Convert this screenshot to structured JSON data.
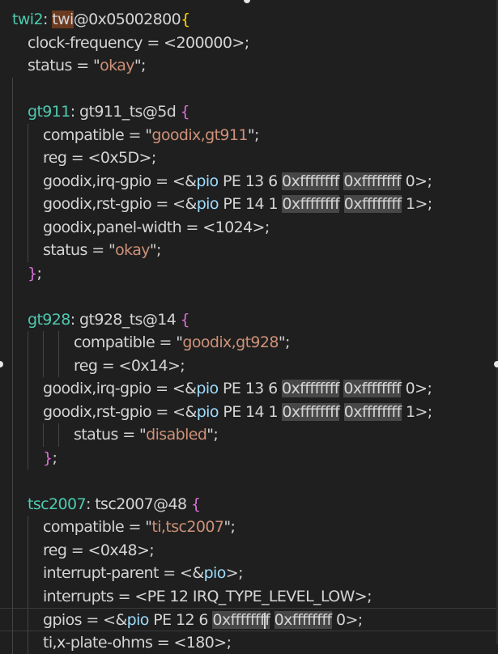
{
  "editor": {
    "lines": [
      "twi2: twi@0x05002800{",
      "clock-frequency = <200000>;",
      "status = \"okay\";",
      "",
      "gt911: gt911_ts@5d {",
      "compatible = \"goodix,gt911\";",
      "reg = <0x5D>;",
      "goodix,irq-gpio = <&pio PE 13 6 0xffffffff 0xffffffff 0>;",
      "goodix,rst-gpio = <&pio PE 14 1 0xffffffff 0xffffffff 1>;",
      "goodix,panel-width = <1024>;",
      "status = \"okay\";",
      "};",
      "",
      "gt928: gt928_ts@14 {",
      "compatible = \"goodix,gt928\";",
      "reg = <0x14>;",
      "goodix,irq-gpio = <&pio PE 13 6 0xffffffff 0xffffffff 0>;",
      "goodix,rst-gpio = <&pio PE 14 1 0xffffffff 0xffffffff 1>;",
      "status = \"disabled\";",
      "};",
      "",
      "tsc2007: tsc2007@48 {",
      "compatible = \"ti,tsc2007\";",
      "reg = <0x48>;",
      "interrupt-parent = <&pio>;",
      "interrupts = <PE 12 IRQ_TYPE_LEVEL_LOW>;",
      "gpios = <&pio PE 12 6 0xffffffff 0xffffffff 0>;",
      "ti,x-plate-ohms = <180>;"
    ]
  },
  "colors": {
    "background": "#1f1f1f",
    "text": "#d4d4d4",
    "label": "#4ec9b0",
    "string": "#ce9178",
    "reference": "#9cdcfe",
    "bracket_level1": "#ffd700",
    "bracket_level2": "#da70d6",
    "hex_highlight": "#474747",
    "word_highlight": "#6b3a20"
  }
}
